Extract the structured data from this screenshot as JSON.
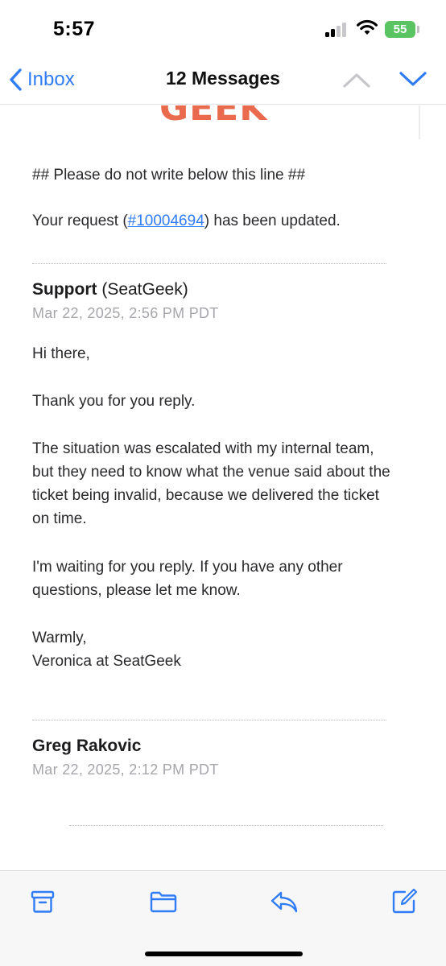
{
  "status_bar": {
    "time": "5:57",
    "battery": "55"
  },
  "nav": {
    "back_label": "Inbox",
    "title": "12 Messages"
  },
  "email": {
    "logo_fragment": "GEEK",
    "separator_line": "## Please do not write below this line ##",
    "request_prefix": "Your request (",
    "request_link": "#10004694",
    "request_suffix": ") has been updated.",
    "messages": [
      {
        "author": "Support",
        "author_org": "(SeatGeek)",
        "timestamp": "Mar 22, 2025, 2:56 PM PDT",
        "greeting": "Hi there,",
        "paragraphs": [
          "Thank you for you reply.",
          "The situation was escalated with my internal team, but they need to know what the venue said about the ticket being invalid, because we delivered the ticket on time.",
          "I'm waiting for you reply. If you have any other questions, please let me know."
        ],
        "signoff": "Warmly,",
        "signature": "Veronica at SeatGeek"
      },
      {
        "author": "Greg Rakovic",
        "timestamp": "Mar 22, 2025, 2:12 PM PDT"
      }
    ]
  },
  "toolbar": {
    "items": [
      "archive-icon",
      "folder-icon",
      "reply-icon",
      "compose-icon"
    ],
    "accent": "#2f7cf6"
  }
}
